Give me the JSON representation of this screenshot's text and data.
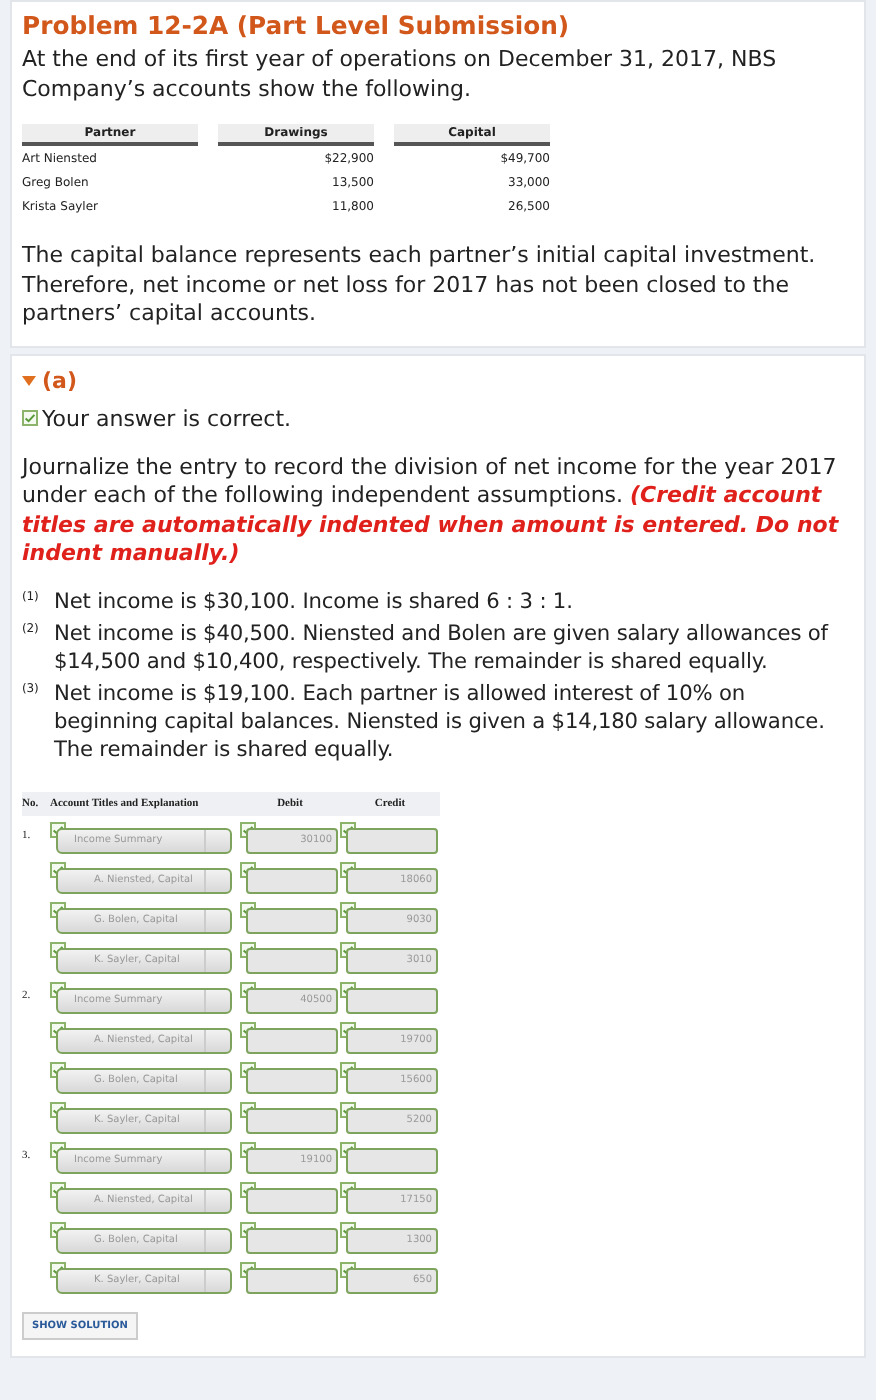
{
  "title": "Problem 12-2A (Part Level Submission)",
  "intro": "At the end of its first year of operations on December 31, 2017, NBS Company’s accounts show the following.",
  "partner_table": {
    "columns": [
      "Partner",
      "Drawings",
      "Capital"
    ],
    "rows": [
      [
        "Art Niensted",
        "$22,900",
        "$49,700"
      ],
      [
        "Greg Bolen",
        "13,500",
        "33,000"
      ],
      [
        "Krista Sayler",
        "11,800",
        "26,500"
      ]
    ]
  },
  "note": "The capital balance represents each partner’s initial capital investment. Therefore, net income or net loss for 2017 has not been closed to the partners’ capital accounts.",
  "part": {
    "label": "(a)",
    "expanded": true
  },
  "result": {
    "text": "Your answer is correct.",
    "correct": true
  },
  "instructions": "Journalize the entry to record the division of net income for the year 2017 under each of the following independent assumptions. **(Credit account titles are automatically indented when amount is entered. Do not indent manually.)**",
  "assumptions": [
    {
      "marker": "(1)",
      "text": "Net income is $30,100. Income is shared 6 : 3 : 1."
    },
    {
      "marker": "(2)",
      "text": "Net income is $40,500. Niensted and Bolen are given salary allowances of $14,500 and $10,400, respectively. The remainder is shared equally."
    },
    {
      "marker": "(3)",
      "text": "Net income is $19,100. Each partner is allowed interest of 10% on beginning capital balances. Niensted is given a $14,180 salary allowance. The remainder is shared equally."
    }
  ],
  "journal": {
    "columns": [
      "No.",
      "Account Titles and Explanation",
      "Debit",
      "Credit"
    ],
    "entries": [
      {
        "no": "1.",
        "account": "Income Summary",
        "indented": false,
        "debit": "30100",
        "correct": true
      },
      {
        "account": "A. Niensted, Capital",
        "indented": true,
        "credit": "18060",
        "correct": true
      },
      {
        "account": "G. Bolen, Capital",
        "indented": true,
        "credit": "9030",
        "correct": true
      },
      {
        "account": "K. Sayler, Capital",
        "indented": true,
        "credit": "3010",
        "correct": true
      },
      {
        "no": "2.",
        "account": "Income Summary",
        "indented": false,
        "debit": "40500",
        "correct": true
      },
      {
        "account": "A. Niensted, Capital",
        "indented": true,
        "credit": "19700",
        "correct": true
      },
      {
        "account": "G. Bolen, Capital",
        "indented": true,
        "credit": "15600",
        "correct": true
      },
      {
        "account": "K. Sayler, Capital",
        "indented": true,
        "credit": "5200",
        "correct": true
      },
      {
        "no": "3.",
        "account": "Income Summary",
        "indented": false,
        "debit": "19100",
        "correct": true
      },
      {
        "account": "A. Niensted, Capital",
        "indented": true,
        "credit": "17150",
        "correct": true
      },
      {
        "account": "G. Bolen, Capital",
        "indented": true,
        "credit": "1300",
        "correct": true
      },
      {
        "account": "K. Sayler, Capital",
        "indented": true,
        "credit": "650",
        "correct": true
      }
    ]
  },
  "show_solution": "SHOW SOLUTION"
}
